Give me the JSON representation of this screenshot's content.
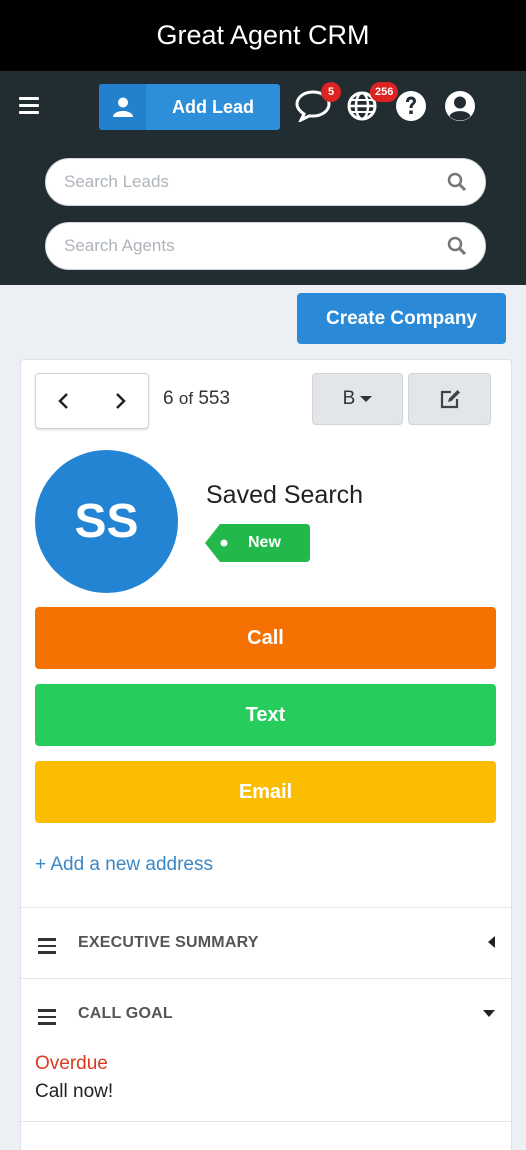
{
  "app": {
    "title": "Great Agent CRM"
  },
  "header": {
    "add_lead_label": "Add Lead",
    "messages_badge": "5",
    "globe_badge": "256",
    "icons": [
      "menu-icon",
      "user-icon",
      "chat-icon",
      "globe-icon",
      "help-icon",
      "account-icon"
    ]
  },
  "search": {
    "leads_placeholder": "Search Leads",
    "agents_placeholder": "Search Agents"
  },
  "toolbar": {
    "create_company_label": "Create Company"
  },
  "lead": {
    "position": "6",
    "of_label": "of",
    "total": "553",
    "view_button": "B",
    "avatar_initials": "SS",
    "name": "Saved Search",
    "status": "New",
    "call_label": "Call",
    "text_label": "Text",
    "email_label": "Email",
    "add_address_label": "+ Add a new address"
  },
  "sections": {
    "executive_summary": "EXECUTIVE SUMMARY",
    "call_goal": "CALL GOAL",
    "call_goal_status": "Overdue",
    "call_goal_text": "Call now!"
  },
  "colors": {
    "title_bg": "#000000",
    "nav_bg": "#222d32",
    "primary": "#2a8ad8",
    "call": "#f57202",
    "text": "#26cd5c",
    "email": "#fbbd00",
    "status_green": "#22b94a",
    "badge_red": "#dd2222",
    "overdue": "#d93a1f"
  }
}
